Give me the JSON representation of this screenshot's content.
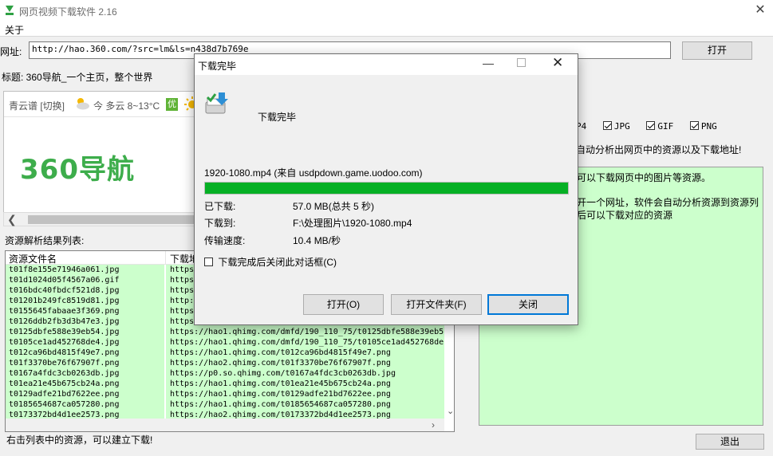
{
  "app": {
    "title": "网页视频下载软件 2.16",
    "menu": [
      "关于"
    ]
  },
  "url_bar": {
    "label": "网址:",
    "value": "http://hao.360.com/?src=lm&ls=n438d7b769e",
    "open_button": "打开"
  },
  "page": {
    "title_line": "标题: 360导航_一个主页，整个世界"
  },
  "browser": {
    "city": "青云谱 [切换]",
    "weather": "今 多云 8~13°C",
    "air_badge": "优",
    "logo": "360导航"
  },
  "resources": {
    "label": "资源解析结果列表:",
    "columns": [
      "资源文件名",
      "下载地"
    ],
    "rows": [
      {
        "name": "t01f8e155e71946a061.jpg",
        "url": "https"
      },
      {
        "name": "t01d1024d05f4567a06.gif",
        "url": "https"
      },
      {
        "name": "t016bdc40fbdcf521d8.jpg",
        "url": "https"
      },
      {
        "name": "t01201b249fc8519d81.jpg",
        "url": "http:"
      },
      {
        "name": "t0155645fabaae3f369.png",
        "url": "https"
      },
      {
        "name": "t0126ddb2fb3d3b47e3.jpg",
        "url": "https"
      },
      {
        "name": "t0125dbfe588e39eb54.jpg",
        "url": "https://hao1.qhimg.com/dmfd/190_110_75/t0125dbfe588e39eb5"
      },
      {
        "name": "t0105ce1ad452768de4.jpg",
        "url": "https://hao1.qhimg.com/dmfd/190_110_75/t0105ce1ad452768de"
      },
      {
        "name": "t012ca96bd4815f49e7.png",
        "url": "https://hao1.qhimg.com/t012ca96bd4815f49e7.png"
      },
      {
        "name": "t01f3370be76f67907f.png",
        "url": "https://hao2.qhimg.com/t01f3370be76f67907f.png"
      },
      {
        "name": "t0167a4fdc3cb0263db.jpg",
        "url": "https://p0.so.qhimg.com/t0167a4fdc3cb0263db.jpg"
      },
      {
        "name": "t01ea21e45b675cb24a.png",
        "url": "https://hao1.qhimg.com/t01ea21e45b675cb24a.png"
      },
      {
        "name": "t0129adfe21bd7622ee.png",
        "url": "https://hao1.qhimg.com/t0129adfe21bd7622ee.png"
      },
      {
        "name": "t0185654687ca057280.png",
        "url": "https://hao1.qhimg.com/t0185654687ca057280.png"
      },
      {
        "name": "t0173372bd4d1ee2573.png",
        "url": "https://hao2.qhimg.com/t0173372bd4d1ee2573.png"
      }
    ]
  },
  "right": {
    "options": [
      {
        "label": "P4",
        "checked": null
      },
      {
        "label": "JPG",
        "checked": true
      },
      {
        "label": "GIF",
        "checked": true
      },
      {
        "label": "PNG",
        "checked": true
      }
    ],
    "desc": "自动分析出网页中的资源以及下载地址!",
    "panel_lines": [
      "可以下载网页中的图片等资源。",
      "开一个网址，软件会自动分析资源到资源列",
      "后可以下载对应的资源"
    ]
  },
  "status": {
    "hint": "右击列表中的资源，可以建立下载!",
    "exit_button": "退出"
  },
  "dialog": {
    "title": "下载完毕",
    "heading": "下载完毕",
    "file_line": "1920-1080.mp4 (来自 usdpdown.game.uodoo.com)",
    "progress": 1.0,
    "downloaded_label": "已下载:",
    "downloaded_value": "57.0 MB(总共 5 秒)",
    "saved_to_label": "下载到:",
    "saved_to_value": "F:\\处理图片\\1920-1080.mp4",
    "speed_label": "传输速度:",
    "speed_value": "10.4 MB/秒",
    "close_after_label": "下载完成后关闭此对话框(C)",
    "close_after_checked": false,
    "buttons": {
      "open": "打开(O)",
      "open_folder": "打开文件夹(F)",
      "close": "关闭"
    },
    "progress_color": "#06b025"
  }
}
